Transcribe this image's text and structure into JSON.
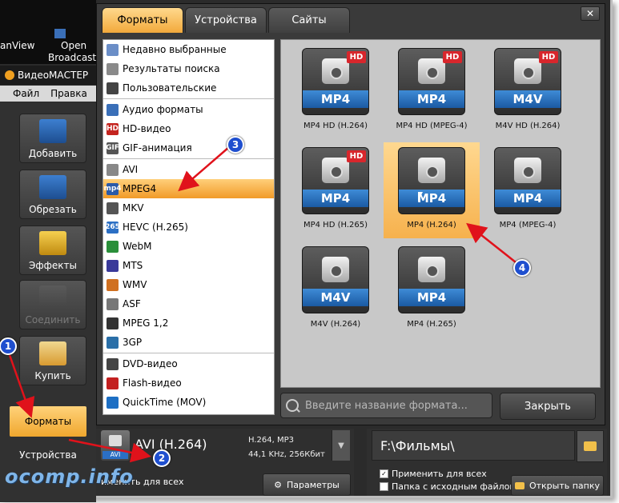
{
  "desktop": {
    "item1": "anView",
    "item2": "Open",
    "item3": "Broadcast"
  },
  "app": {
    "title": "ВидеоМАСТЕР",
    "menu": [
      "Файл",
      "Правка",
      "С"
    ]
  },
  "tools": [
    {
      "label": "Добавить",
      "icon": "film-add-icon"
    },
    {
      "label": "Обрезать",
      "icon": "film-cut-icon"
    },
    {
      "label": "Эффекты",
      "icon": "magic-wand-icon"
    },
    {
      "label": "Соединить",
      "icon": "join-icon"
    },
    {
      "label": "Купить",
      "icon": "credit-card-icon"
    }
  ],
  "nav": {
    "formats": "Форматы",
    "devices": "Устройства"
  },
  "dialog": {
    "tabs": [
      "Форматы",
      "Устройства",
      "Сайты"
    ],
    "close_symbol": "✕",
    "categories": [
      {
        "label": "Недавно выбранные",
        "icon": "recent-icon"
      },
      {
        "label": "Результаты поиска",
        "icon": "search-results-icon"
      },
      {
        "label": "Пользовательские",
        "icon": "user-icon"
      },
      {
        "label": "Аудио форматы",
        "icon": "music-note-icon"
      },
      {
        "label": "HD-видео",
        "icon": "hd-icon",
        "badge": "HD"
      },
      {
        "label": "GIF-анимация",
        "icon": "gif-icon",
        "badge": "GIF"
      },
      {
        "label": "AVI",
        "icon": "avi-icon"
      },
      {
        "label": "MPEG4",
        "icon": "mp4-icon",
        "badge": "mp4"
      },
      {
        "label": "MKV",
        "icon": "mkv-icon"
      },
      {
        "label": "HEVC (H.265)",
        "icon": "hevc-icon",
        "badge": "265"
      },
      {
        "label": "WebM",
        "icon": "webm-icon"
      },
      {
        "label": "MTS",
        "icon": "mts-icon"
      },
      {
        "label": "WMV",
        "icon": "wmv-icon"
      },
      {
        "label": "ASF",
        "icon": "asf-icon"
      },
      {
        "label": "MPEG 1,2",
        "icon": "mpeg-icon"
      },
      {
        "label": "3GP",
        "icon": "3gp-icon"
      },
      {
        "label": "DVD-видео",
        "icon": "dvd-icon"
      },
      {
        "label": "Flash-видео",
        "icon": "flash-icon"
      },
      {
        "label": "QuickTime (MOV)",
        "icon": "quicktime-icon"
      }
    ],
    "selected_category": "MPEG4",
    "formats": [
      {
        "tile": "MP4",
        "hd": "HD",
        "label": "MP4 HD (H.264)"
      },
      {
        "tile": "MP4",
        "hd": "HD",
        "label": "MP4 HD (MPEG-4)"
      },
      {
        "tile": "M4V",
        "hd": "HD",
        "label": "M4V HD (H.264)"
      },
      {
        "tile": "MP4",
        "hd": "HD",
        "label": "MP4 HD (H.265)"
      },
      {
        "tile": "MP4",
        "hd": "",
        "label": "MP4 (H.264)"
      },
      {
        "tile": "MP4",
        "hd": "",
        "label": "MP4 (MPEG-4)"
      },
      {
        "tile": "M4V",
        "hd": "",
        "label": "M4V (H.264)"
      },
      {
        "tile": "MP4",
        "hd": "",
        "label": "MP4 (H.265)"
      }
    ],
    "selected_format": "MP4 (H.264)",
    "search": {
      "placeholder": "Введите название формата..."
    },
    "close_button": "Закрыть"
  },
  "output": {
    "thumb_label": "AVI",
    "current_format": "AVI (H.264)",
    "specs_line1": "H.264, MP3",
    "specs_line2": "44,1 KHz, 256Кбит",
    "apply_all_left": "именить для всех",
    "params_button": "Параметры",
    "folder_path": "F:\\Фильмы\\",
    "apply_all_right": "Применить для всех",
    "same_folder": "Папка с исходным файлом",
    "open_folder_button": "Открыть папку"
  },
  "annotations": [
    "1",
    "2",
    "3",
    "4"
  ],
  "watermark": "ocomp.info",
  "colors": {
    "accent_orange": "#f2a93b",
    "badge_blue": "#1f4fcf",
    "arrow_red": "#e0121b",
    "tile_blue": "#2b6fc4"
  }
}
